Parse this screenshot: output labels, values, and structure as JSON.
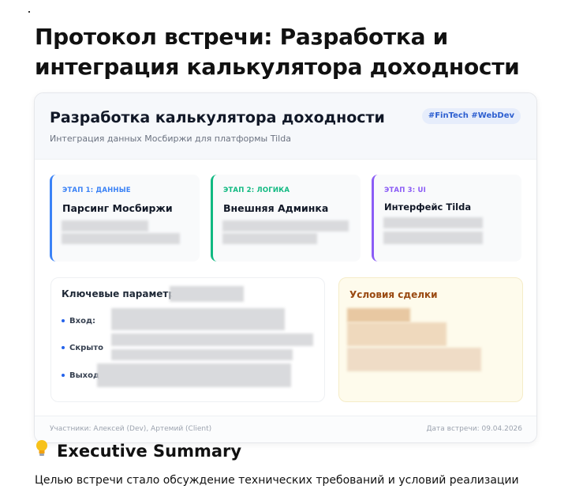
{
  "page": {
    "title": "Протокол встречи: Разработка и интеграция калькулятора доходности"
  },
  "card": {
    "title": "Разработка калькулятора доходности",
    "subtitle": "Интеграция данных Мосбиржи для платформы Tilda",
    "tags": "#FinTech #WebDev",
    "stages": [
      {
        "label": "ЭТАП 1: ДАННЫЕ",
        "name": "Парсинг Мосбиржи",
        "color": "#3b82f6"
      },
      {
        "label": "ЭТАП 2: ЛОГИКА",
        "name": "Внешняя Админка",
        "color": "#10b981"
      },
      {
        "label": "ЭТАП 3: UI",
        "name": "Интерфейс Tilda",
        "color": "#8b5cf6"
      }
    ],
    "params": {
      "title": "Ключевые параметры",
      "items": [
        "Вход:",
        "Скрыто",
        "Выход:"
      ]
    },
    "deal": {
      "title": "Условия сделки"
    },
    "footer": {
      "participants": "Участники: Алексей (Dev), Артемий (Client)",
      "date": "Дата встречи: 09.04.2026"
    }
  },
  "summary": {
    "icon": "lightbulb-icon",
    "heading": "Executive Summary",
    "text": "Целью встречи стало обсуждение технических требований и условий реализации"
  }
}
